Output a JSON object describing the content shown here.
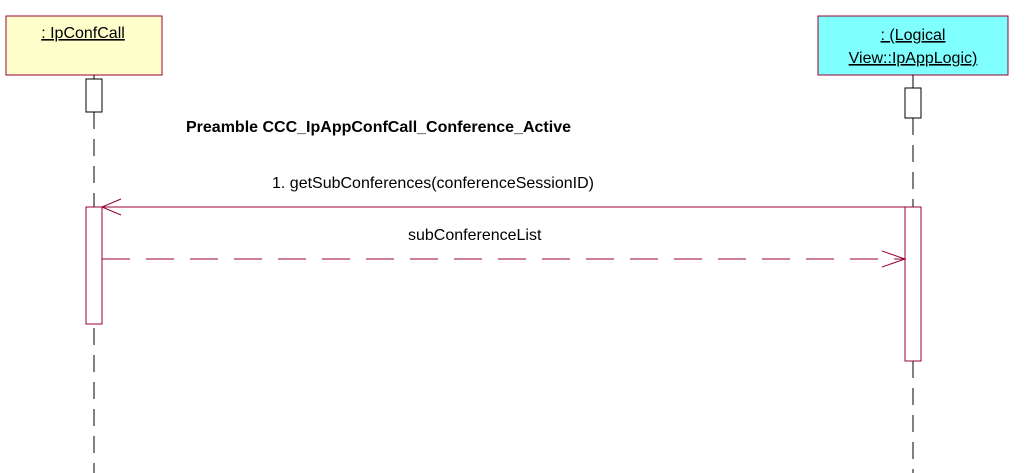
{
  "colors": {
    "ipconfcall_fill": "#FFFFCC",
    "ipconfcall_border": "#990033",
    "ipapplogic_fill": "#80FFFF",
    "ipapplogic_border": "#990033",
    "message_line": "#990033",
    "lifeline": "#000000"
  },
  "objects": [
    {
      "id": "ipconfcall",
      "label_lines": [
        ": IpConfCall"
      ]
    },
    {
      "id": "ipapplogic",
      "label_lines": [
        ": (Logical",
        "View::IpAppLogic)"
      ]
    }
  ],
  "note": "Preamble CCC_IpAppConfCall_Conference_Active",
  "messages": [
    {
      "id": "msg1",
      "label": "1. getSubConferences(conferenceSessionID)",
      "type": "call",
      "from": "ipapplogic",
      "to": "ipconfcall"
    },
    {
      "id": "msg2",
      "label": "subConferenceList",
      "type": "return",
      "from": "ipconfcall",
      "to": "ipapplogic"
    }
  ]
}
